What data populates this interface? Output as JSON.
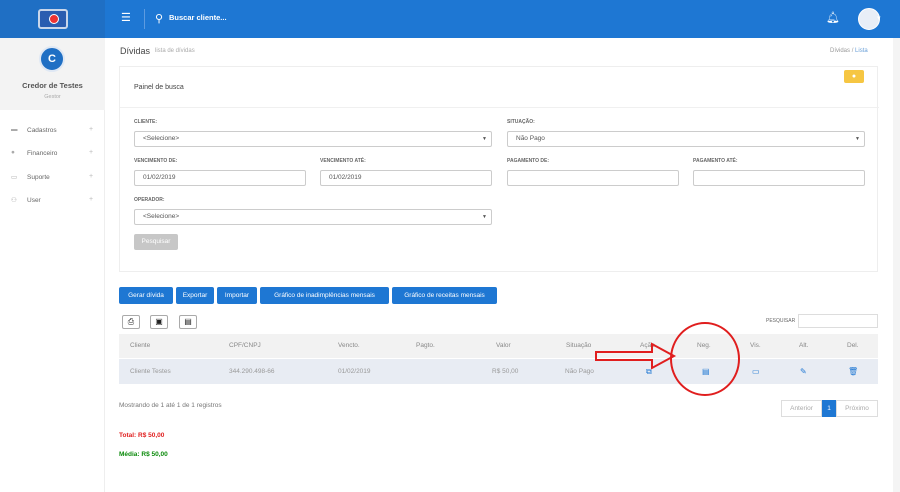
{
  "topbar": {
    "search_placeholder": "Buscar cliente..."
  },
  "profile": {
    "initial": "C",
    "name": "Credor de Testes",
    "role": "Gestor"
  },
  "sidebar": {
    "items": [
      {
        "label": "Cadastros",
        "icon": "folder-icon"
      },
      {
        "label": "Financeiro",
        "icon": "money-icon"
      },
      {
        "label": "Suporte",
        "icon": "chat-icon"
      },
      {
        "label": "User",
        "icon": "user-icon"
      }
    ]
  },
  "breadcrumb": {
    "title": "Dívidas",
    "subtitle": "lista de dívidas",
    "path1": "Dívidas",
    "sep": "/",
    "path2": "Lista"
  },
  "search_panel": {
    "title": "Painel de busca",
    "cliente_label": "CLIENTE:",
    "cliente_value": "<Selecione>",
    "situacao_label": "SITUAÇÃO:",
    "situacao_value": "Não Pago",
    "venc_de_label": "VENCIMENTO DE:",
    "venc_de_value": "01/02/2019",
    "venc_ate_label": "VENCIMENTO ATÉ:",
    "venc_ate_value": "01/02/2019",
    "pag_de_label": "PAGAMENTO DE:",
    "pag_de_value": "",
    "pag_ate_label": "PAGAMENTO ATÉ:",
    "pag_ate_value": "",
    "operador_label": "OPERADOR:",
    "operador_value": "<Selecione>",
    "search_button": "Pesquisar"
  },
  "actions": [
    "Gerar dívida",
    "Exportar",
    "Importar",
    "Gráfico de inadimplências mensais",
    "Gráfico de receitas mensais"
  ],
  "table": {
    "search_label": "PESQUISAR",
    "headers": [
      "Cliente",
      "CPF/CNPJ",
      "Vencto.",
      "Pagto.",
      "Valor",
      "Situação",
      "Ação",
      "Neg.",
      "Vis.",
      "Alt.",
      "Del."
    ],
    "rows": [
      {
        "cliente": "Cliente Testes",
        "cpf": "344.290.498-66",
        "vencto": "01/02/2019",
        "pagto": "",
        "valor": "R$ 50,00",
        "situacao": "Não Pago"
      }
    ]
  },
  "footer": {
    "info": "Mostrando de 1 até 1 de 1 registros",
    "prev": "Anterior",
    "page": "1",
    "next": "Próximo",
    "total": "Total: R$ 50,00",
    "media": "Média: R$ 50,00"
  }
}
